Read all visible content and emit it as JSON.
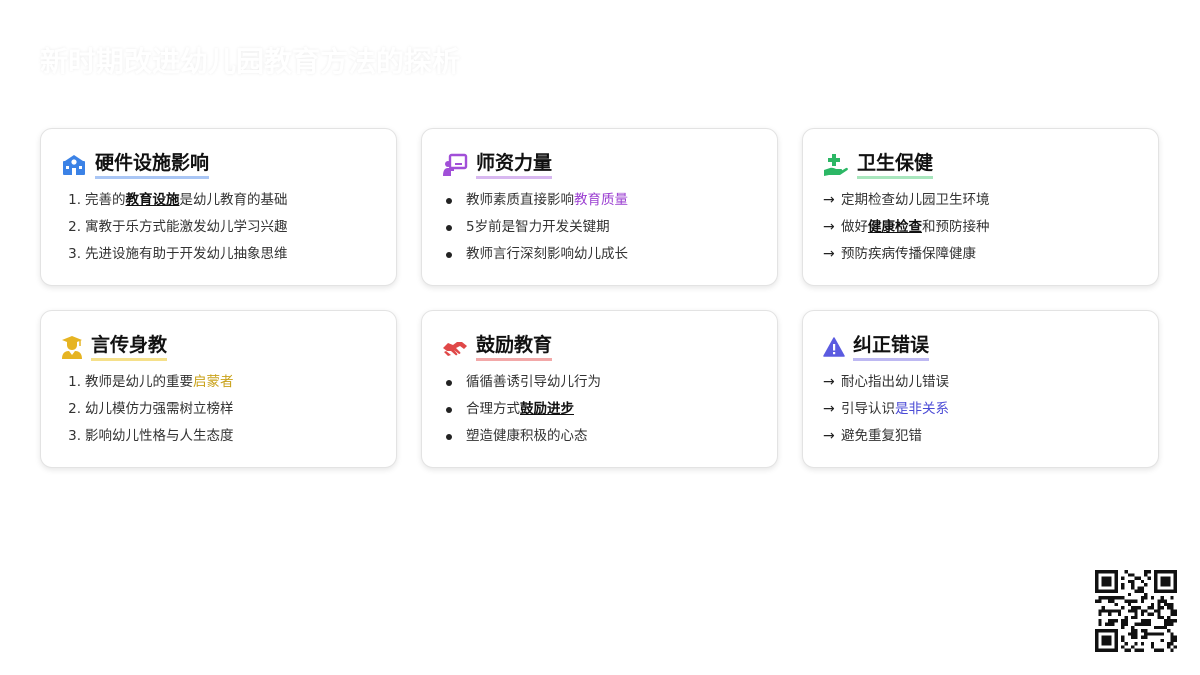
{
  "title": "新时期改进幼儿园教育方法的探析",
  "cards": [
    {
      "title": "硬件设施影响",
      "underline_color": "#a9c6f5",
      "items": [
        {
          "marker": "1.",
          "pre": "完善的",
          "hl": "教育设施",
          "post": "是幼儿教育的基础",
          "hl_style": "bold-underline"
        },
        {
          "marker": "2.",
          "pre": "寓教于乐方式能激发幼儿学习兴趣"
        },
        {
          "marker": "3.",
          "pre": "先进设施有助于开发幼儿抽象思维"
        }
      ]
    },
    {
      "title": "师资力量",
      "underline_color": "#d8b8f0",
      "items": [
        {
          "pre": "教师素质直接影响",
          "hl": "教育质量",
          "hl_color": "#9b3fd1"
        },
        {
          "pre": "5岁前是智力开发关键期"
        },
        {
          "pre": "教师言行深刻影响幼儿成长"
        }
      ]
    },
    {
      "title": "卫生保健",
      "underline_color": "#a8e6bd",
      "items": [
        {
          "marker": "→",
          "pre": "定期检查幼儿园卫生环境"
        },
        {
          "marker": "→",
          "pre": "做好",
          "hl": "健康检查",
          "post": "和预防接种",
          "hl_style": "bold-underline"
        },
        {
          "marker": "→",
          "pre": "预防疾病传播保障健康"
        }
      ]
    },
    {
      "title": "言传身教",
      "underline_color": "#f5e08a",
      "items": [
        {
          "marker": "1.",
          "pre": "教师是幼儿的重要",
          "hl": "启蒙者",
          "hl_color": "#c9a21a"
        },
        {
          "marker": "2.",
          "pre": "幼儿模仿力强需树立榜样"
        },
        {
          "marker": "3.",
          "pre": "影响幼儿性格与人生态度"
        }
      ]
    },
    {
      "title": "鼓励教育",
      "underline_color": "#f2a8a8",
      "items": [
        {
          "pre": "循循善诱引导幼儿行为"
        },
        {
          "pre": "合理方式",
          "hl": "鼓励进步",
          "hl_style": "bold-underline"
        },
        {
          "pre": "塑造健康积极的心态"
        }
      ]
    },
    {
      "title": "纠正错误",
      "underline_color": "#bdb8f2",
      "items": [
        {
          "marker": "→",
          "pre": "耐心指出幼儿错误"
        },
        {
          "marker": "→",
          "pre": "引导认识",
          "hl": "是非关系",
          "hl_color": "#4a4ad6"
        },
        {
          "marker": "→",
          "pre": "避免重复犯错"
        }
      ]
    }
  ],
  "icons": [
    "school-icon",
    "teacher-icon",
    "health-care-icon",
    "graduate-icon",
    "handshake-icon",
    "warning-icon",
    "qr-code-icon"
  ],
  "colors": {
    "blue": "#3b82e6",
    "purple": "#a14fd8",
    "green": "#2cb765",
    "gold": "#e6b422",
    "red": "#e04848",
    "indigo": "#5b5be0"
  }
}
